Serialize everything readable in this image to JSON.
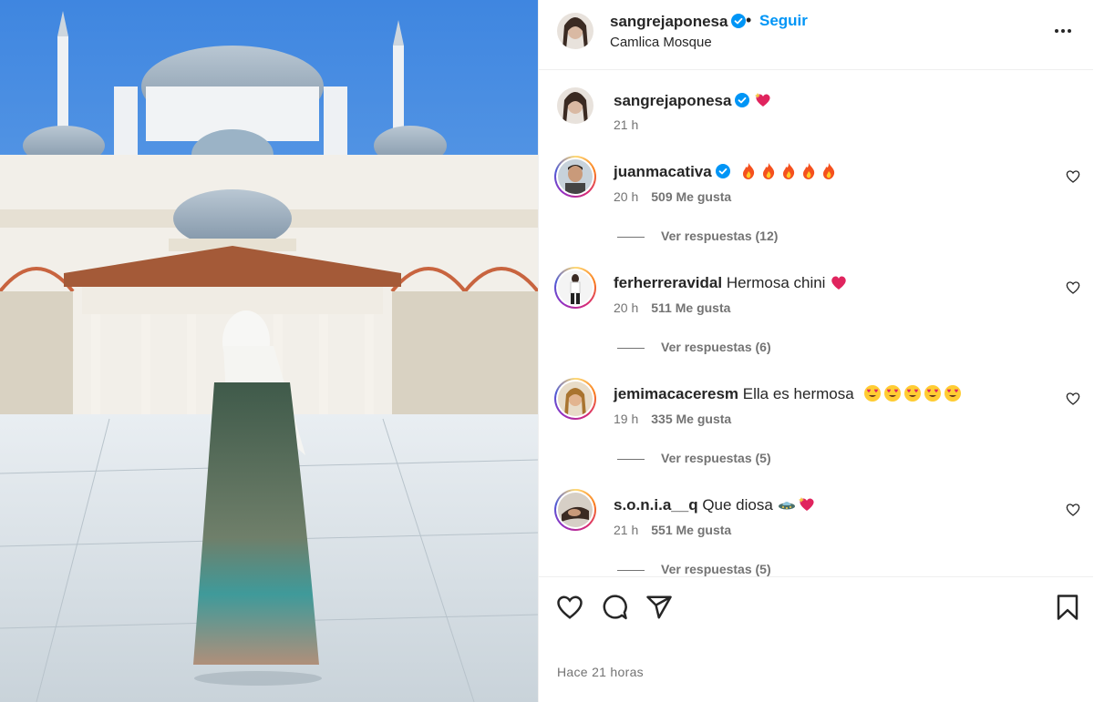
{
  "post": {
    "username": "sangrejaponesa",
    "follow_label": "Seguir",
    "location": "Camlica Mosque",
    "dot": "•"
  },
  "caption": {
    "username": "sangrejaponesa",
    "time": "21 h"
  },
  "comments": [
    {
      "username": "juanmacativa",
      "text": "",
      "time": "20 h",
      "likes": "509 Me gusta",
      "replies": "Ver respuestas (12)"
    },
    {
      "username": "ferherreravidal",
      "text": "Hermosa chini",
      "time": "20 h",
      "likes": "511 Me gusta",
      "replies": "Ver respuestas (6)"
    },
    {
      "username": "jemimacaceresm",
      "text": "Ella es hermosa",
      "time": "19 h",
      "likes": "335 Me gusta",
      "replies": "Ver respuestas (5)"
    },
    {
      "username": "s.o.n.i.a__q",
      "text": "Que diosa",
      "time": "21 h",
      "likes": "551 Me gusta",
      "replies": "Ver respuestas (5)"
    }
  ],
  "footer": {
    "time_ago": "Hace 21 horas"
  },
  "icons": {
    "verified": "verified-badge-icon",
    "more": "more-options-icon",
    "like": "heart-icon",
    "comment": "comment-icon",
    "share": "send-icon",
    "save": "bookmark-icon"
  },
  "colors": {
    "accent": "#0095f6",
    "verified": "#0095f6",
    "muted": "#737373",
    "text": "#262626"
  }
}
